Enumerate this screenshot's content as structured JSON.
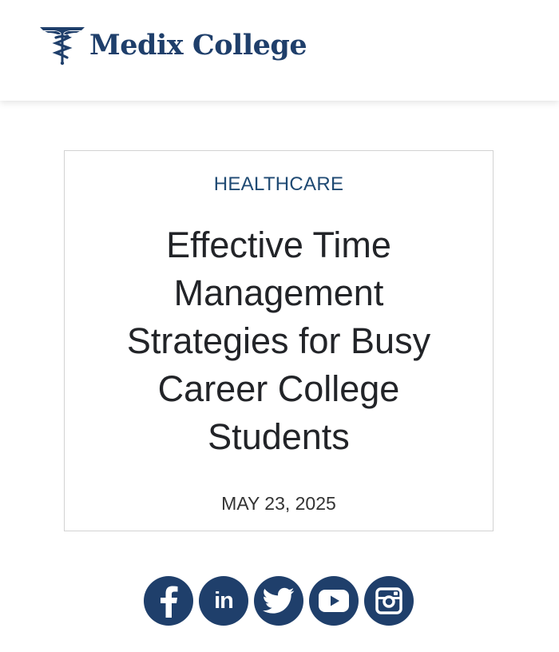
{
  "brand": {
    "name": "Medix College",
    "logo_icon": "caduceus-icon",
    "color": "#1f3f6b"
  },
  "post": {
    "category": "HEALTHCARE",
    "title": "Effective Time Management Strategies for Busy Career College Students",
    "date": "MAY 23, 2025"
  },
  "social": [
    {
      "network": "facebook",
      "icon": "facebook-icon"
    },
    {
      "network": "linkedin",
      "icon": "linkedin-icon",
      "label": "in"
    },
    {
      "network": "twitter",
      "icon": "twitter-icon"
    },
    {
      "network": "youtube",
      "icon": "youtube-icon"
    },
    {
      "network": "instagram",
      "icon": "instagram-icon"
    }
  ]
}
